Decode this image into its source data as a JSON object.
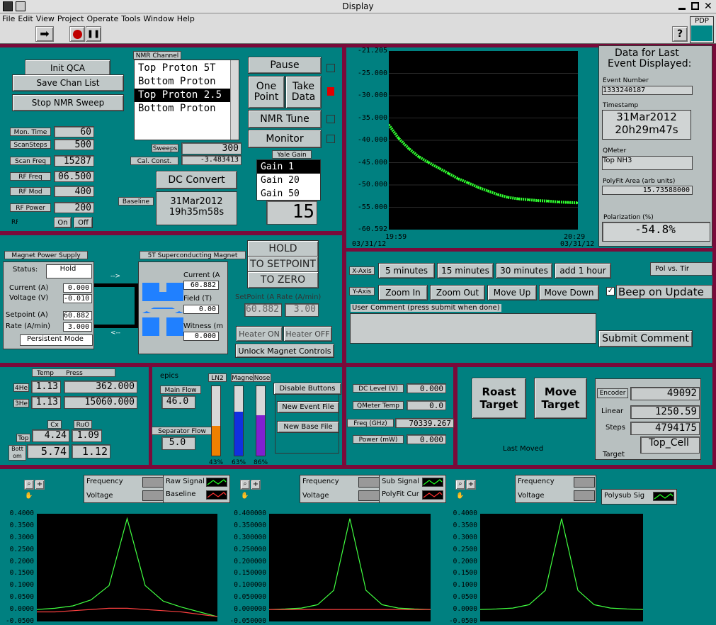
{
  "window": {
    "title": "Display"
  },
  "menu": [
    "File",
    "Edit",
    "View",
    "Project",
    "Operate",
    "Tools",
    "Window",
    "Help"
  ],
  "toolbar": {
    "pdp": "PDP"
  },
  "ctrl": {
    "init": "Init QCA",
    "save": "Save Chan List",
    "stop": "Stop NMR Sweep"
  },
  "params": [
    {
      "label": "Mon. Time",
      "value": "60"
    },
    {
      "label": "ScanSteps",
      "value": "500"
    },
    {
      "label": "Scan Freq",
      "value": "15287"
    },
    {
      "label": "RF Freq",
      "value": "06.500"
    },
    {
      "label": "RF Mod",
      "value": "400"
    },
    {
      "label": "RF Power",
      "value": "200"
    }
  ],
  "rf": {
    "label": "RF",
    "on": "On",
    "off": "Off"
  },
  "nmr": {
    "label": "NMR Channel",
    "items": [
      "Top Proton 5T",
      "Bottom Proton",
      "Top Proton 2.5",
      "Bottom Proton"
    ]
  },
  "sweeps": {
    "label": "Sweeps",
    "value": "300"
  },
  "cal": {
    "label": "Cal. Const.",
    "value": "-3.483413"
  },
  "dc": {
    "label": "DC Convert",
    "baseline_label": "Baseline",
    "baseline_date": "31Mar2012",
    "baseline_time": "19h35m58s"
  },
  "yale": {
    "label": "Yale Gain",
    "items": [
      "Gain 1",
      "Gain 20",
      "Gain 50"
    ],
    "value": "15"
  },
  "actions": {
    "pause": "Pause",
    "one": "One",
    "point": "Point",
    "take": "Take",
    "data": "Data",
    "tune": "NMR Tune",
    "monitor": "Monitor"
  },
  "trend": {
    "yticks": [
      "-21.205",
      "-25.000",
      "-30.000",
      "-35.000",
      "-40.000",
      "-45.000",
      "-50.000",
      "-55.000",
      "-60.592"
    ],
    "x0_time": "19:59",
    "x0_date": "03/31/12",
    "x1_time": "20:29",
    "x1_date": "03/31/12"
  },
  "event": {
    "title1": "Data for Last",
    "title2": "Event Displayed:",
    "num_label": "Event Number",
    "num": "1333240187",
    "ts_label": "Timestamp",
    "ts_date": "31Mar2012",
    "ts_time": "20h29m47s",
    "qm_label": "QMeter",
    "qm": "Top NH3",
    "pf_label": "PolyFit Area (arb units)",
    "pf": "15.73588000",
    "pol_label": "Polarization (%)",
    "pol": "-54.8%"
  },
  "xaxis": {
    "label": "X-Axis",
    "b": [
      "5 minutes",
      "15 minutes",
      "30 minutes",
      "add 1 hour"
    ]
  },
  "yaxis": {
    "label": "Y-Axis",
    "b": [
      "Zoom In",
      "Zoom Out",
      "Move Up",
      "Move Down"
    ]
  },
  "pol_vs": "Pol vs. Tir",
  "beep": "Beep on Update",
  "comment": {
    "label": "User Comment (press submit when done)",
    "submit": "Submit Comment"
  },
  "mps": {
    "label": "Magnet Power Supply",
    "status_l": "Status:",
    "status": "Hold",
    "cur_l": "Current (A)",
    "cur": "0.000",
    "volt_l": "Voltage (V)",
    "volt": "-0.010",
    "sp_l": "Setpoint (A)",
    "sp": "60.882",
    "rate_l": "Rate (A/min)",
    "rate": "3.000",
    "mode": "Persistent Mode"
  },
  "sc": {
    "label": "5T Superconducting Magnet",
    "cur_l": "Current (A",
    "cur": "60.882",
    "field_l": "Field (T)",
    "field": "0.00",
    "wit_l": "Witness (m",
    "wit": "0.000"
  },
  "hold": {
    "hold": "HOLD",
    "to_sp": "TO SETPOINT",
    "to_zero": "TO ZERO",
    "sp_l": "SetPoint (A Rate (A/min)",
    "sp": "60.882",
    "rate": "3.00",
    "h_on": "Heater ON",
    "h_off": "Heater OFF",
    "unlock": "Unlock Magnet Controls"
  },
  "temps": {
    "temp_h": "Temp",
    "press_h": "Press",
    "he4_l": "4He",
    "he4_t": "1.13",
    "he4_p": "362.000",
    "he3_l": "3He",
    "he3_t": "1.13",
    "he3_p": "15060.000",
    "cx_h": "Cx",
    "ruo_h": "RuO",
    "top_l": "Top",
    "top_cx": "4.24",
    "top_ruo": "1.09",
    "bot_l": "Bott om",
    "bot_cx": "5.74",
    "bot_ruo": "1.12"
  },
  "epics": {
    "label": "epics",
    "mf_l": "Main Flow",
    "mf": "46.0",
    "sf_l": "Separator Flow",
    "sf": "5.0",
    "bars": [
      {
        "label": "LN2",
        "value": "43%",
        "pct": 0.43,
        "color": "#f08000"
      },
      {
        "label": "Magnet",
        "value": "63%",
        "pct": 0.63,
        "color": "#1030e0"
      },
      {
        "label": "Nose",
        "value": "86%",
        "pct": 0.58,
        "color": "#8020d0"
      }
    ]
  },
  "files": {
    "disable": "Disable Buttons",
    "new_event": "New Event File",
    "new_base": "New Base File"
  },
  "meas": [
    {
      "label": "DC Level (V)",
      "value": "0.000"
    },
    {
      "label": "QMeter Temp",
      "value": "0.0"
    },
    {
      "label": "Freq (GHz)",
      "value": "70339.267"
    },
    {
      "label": "Power (mW)",
      "value": "0.000"
    }
  ],
  "target": {
    "roast": "Roast Target",
    "move": "Move Target",
    "last": "Last Moved",
    "enc_l": "Encoder",
    "enc": "49092",
    "lin_l": "Linear",
    "lin": "1250.59",
    "steps_l": "Steps",
    "steps": "4794175",
    "tgt_l": "Target",
    "tgt": "Top_Cell"
  },
  "plots": [
    {
      "leg": [
        "Frequency",
        "Voltage"
      ],
      "series": [
        "Raw Signal",
        "Baseline"
      ],
      "yticks": [
        "0.4000",
        "0.3500",
        "0.3000",
        "0.2500",
        "0.2000",
        "0.1500",
        "0.1000",
        "0.0500",
        "0.0000",
        "-0.0500"
      ]
    },
    {
      "leg": [
        "Frequency",
        "Voltage"
      ],
      "series": [
        "Sub Signal",
        "PolyFit Cur"
      ],
      "yticks": [
        "0.400000",
        "0.350000",
        "0.300000",
        "0.250000",
        "0.200000",
        "0.150000",
        "0.100000",
        "0.050000",
        "0.000000",
        "-0.050000"
      ]
    },
    {
      "leg": [
        "Frequency",
        "Voltage"
      ],
      "series": [
        "Polysub Sig"
      ],
      "yticks": [
        "0.4000",
        "0.3500",
        "0.3000",
        "0.2500",
        "0.2000",
        "0.1500",
        "0.1000",
        "0.0500",
        "0.0000",
        "-0.0500"
      ]
    }
  ],
  "chart_data": [
    {
      "type": "line",
      "title": "",
      "xlabel": "",
      "ylabel": "",
      "x": [
        "03/31/12 19:59",
        "03/31/12 20:29"
      ],
      "ylim": [
        -60.592,
        -21.205
      ],
      "series": [
        {
          "values": [
            -37.5,
            -40.5,
            -42.7,
            -44.5,
            -45.8,
            -47.0,
            -48.2,
            -49.4,
            -50.3,
            -51.3,
            -52.1,
            -52.9,
            -53.5,
            -53.8,
            -54.0,
            -54.2,
            -54.3,
            -54.5,
            -54.6,
            -54.7
          ]
        }
      ]
    },
    {
      "type": "line",
      "ylim": [
        -0.05,
        0.4
      ],
      "series": [
        {
          "name": "Raw Signal",
          "values": [
            0.0,
            0.005,
            0.015,
            0.04,
            0.1,
            0.38,
            0.1,
            0.035,
            0.01,
            -0.01,
            -0.03
          ]
        },
        {
          "name": "Baseline",
          "values": [
            -0.01,
            -0.01,
            -0.005,
            0.0,
            0.005,
            0.005,
            0.0,
            -0.005,
            -0.01,
            -0.02,
            -0.03
          ]
        }
      ]
    },
    {
      "type": "line",
      "ylim": [
        -0.05,
        0.4
      ],
      "series": [
        {
          "name": "Sub Signal",
          "values": [
            0.0,
            0.002,
            0.006,
            0.02,
            0.08,
            0.38,
            0.08,
            0.02,
            0.006,
            0.002,
            0.0
          ]
        },
        {
          "name": "PolyFit Cur",
          "values": [
            0.0,
            0.0,
            0.0,
            0.0,
            0.0,
            0.0,
            0.0,
            0.0,
            0.0,
            0.0,
            0.0
          ]
        }
      ]
    },
    {
      "type": "line",
      "ylim": [
        -0.05,
        0.4
      ],
      "series": [
        {
          "name": "Polysub Sig",
          "values": [
            0.0,
            0.002,
            0.006,
            0.02,
            0.08,
            0.38,
            0.08,
            0.02,
            0.006,
            0.002,
            0.0
          ]
        }
      ]
    }
  ]
}
